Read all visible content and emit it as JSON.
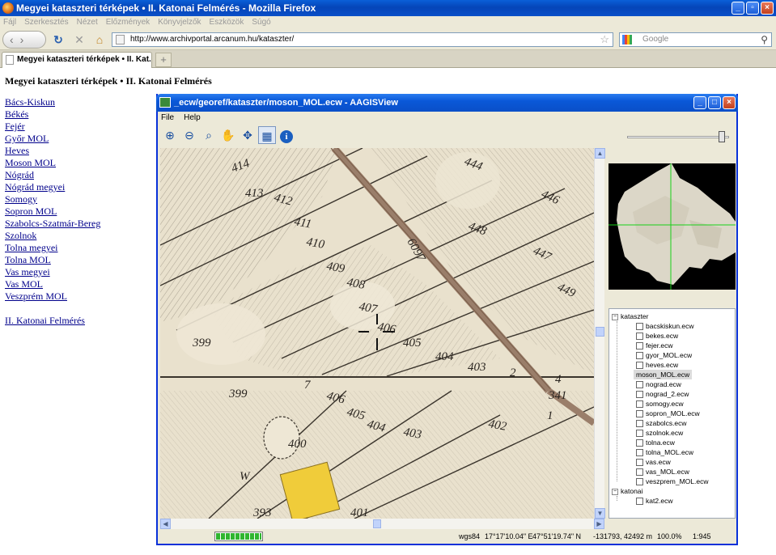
{
  "browser": {
    "window_title": "Megyei kataszteri térképek • II. Katonai Felmérés - Mozilla Firefox",
    "menu": [
      "Fájl",
      "Szerkesztés",
      "Nézet",
      "Előzmények",
      "Könyvjelzők",
      "Eszközök",
      "Súgó"
    ],
    "url": "http://www.archivportal.arcanum.hu/kataszter/",
    "search_placeholder": "Google",
    "tab_label": "Megyei kataszteri térképek • II. Kat...",
    "new_tab": "+"
  },
  "page": {
    "heading": "Megyei kataszteri térképek • II. Katonai Felmérés",
    "links": [
      "Bács-Kiskun",
      "Békés",
      "Fejér",
      "Győr MOL",
      "Heves",
      "Moson MOL",
      "Nógrád",
      "Nógrád megyei",
      "Somogy",
      "Sopron MOL",
      "Szabolcs-Szatmár-Bereg",
      "Szolnok",
      "Tolna megyei",
      "Tolna MOL",
      "Vas megyei",
      "Vas MOL",
      "Veszprém MOL"
    ],
    "extra_link": "II. Katonai Felmérés"
  },
  "gis": {
    "title": "_ecw/georef/kataszter/moson_MOL.ecw - AAGISView",
    "menu": [
      "File",
      "Help"
    ],
    "tools": [
      "zoom-in-icon",
      "zoom-out-icon",
      "zoom-select-icon",
      "pan-icon",
      "move-icon",
      "layers-icon",
      "info-icon"
    ],
    "slider_value": 0.96,
    "parcels": [
      "414",
      "413",
      "412",
      "444",
      "446",
      "411",
      "410",
      "448",
      "447",
      "409",
      "408",
      "449",
      "407",
      "406",
      "405",
      "404",
      "403",
      "2",
      "399",
      "399",
      "7",
      "406",
      "405",
      "404",
      "403",
      "402",
      "400",
      "393",
      "401",
      "W",
      "341",
      "4",
      "1",
      "6097"
    ],
    "tree": {
      "groups": [
        {
          "label": "kataszter",
          "items": [
            "bacskiskun.ecw",
            "bekes.ecw",
            "fejer.ecw",
            "gyor_MOL.ecw",
            "heves.ecw",
            "moson_MOL.ecw",
            "nograd.ecw",
            "nograd_2.ecw",
            "somogy.ecw",
            "sopron_MOL.ecw",
            "szabolcs.ecw",
            "szolnok.ecw",
            "tolna.ecw",
            "tolna_MOL.ecw",
            "vas.ecw",
            "vas_MOL.ecw",
            "veszprem_MOL.ecw"
          ],
          "selected": "moson_MOL.ecw"
        },
        {
          "label": "katonai",
          "items": [
            "kat2.ecw"
          ]
        }
      ]
    },
    "status": {
      "progress": 1.0,
      "proj": "wgs84",
      "lon": "17°17'10.04\" E",
      "lat": "47°51'19.74\" N",
      "xy": "-131793, 42492 m",
      "zoom": "100.0%",
      "scale": "1:945"
    }
  }
}
